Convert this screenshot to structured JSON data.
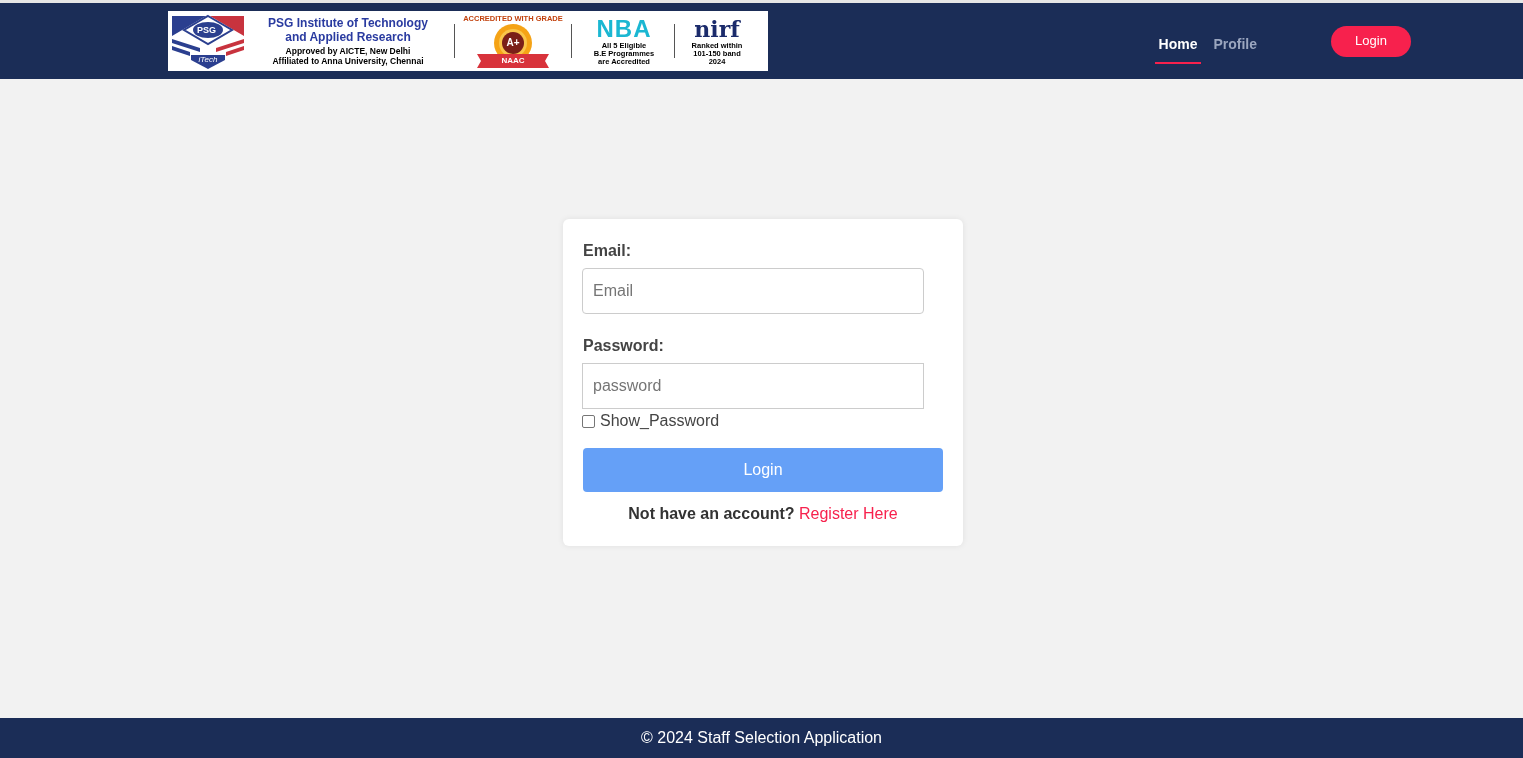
{
  "header": {
    "banner": {
      "shield": {
        "top": "PSG",
        "bottom": "iTech"
      },
      "institute_name": [
        "PSG Institute of Technology",
        "and Applied Research"
      ],
      "approval": [
        "Approved by AICTE, New Delhi",
        "Affiliated to Anna University, Chennai"
      ],
      "naac": {
        "arc": "ACCREDITED WITH GRADE",
        "grade": "A+",
        "ribbon": "NAAC"
      },
      "nba": {
        "logo": "NBA",
        "note": [
          "All 5 Eligible",
          "B.E Programmes",
          "are Accredited"
        ]
      },
      "nirf": {
        "logo": "nirf",
        "note": [
          "Ranked within",
          "101-150 band",
          "2024"
        ]
      }
    },
    "nav": [
      {
        "label": "Home",
        "selected": true
      },
      {
        "label": "Profile",
        "selected": false
      }
    ],
    "login_button": "Login"
  },
  "login_form": {
    "fields": [
      {
        "kind": "email",
        "label": "Email:",
        "placeholder": "Email"
      },
      {
        "kind": "password",
        "label": "Password:",
        "placeholder": "password"
      }
    ],
    "show_password": {
      "label": "Show_Password",
      "checked": false
    },
    "submit": "Login",
    "prompt": {
      "text": "Not have an account?",
      "link": "Register Here"
    }
  },
  "footer": {
    "text": "© 2024 Staff Selection Application"
  }
}
